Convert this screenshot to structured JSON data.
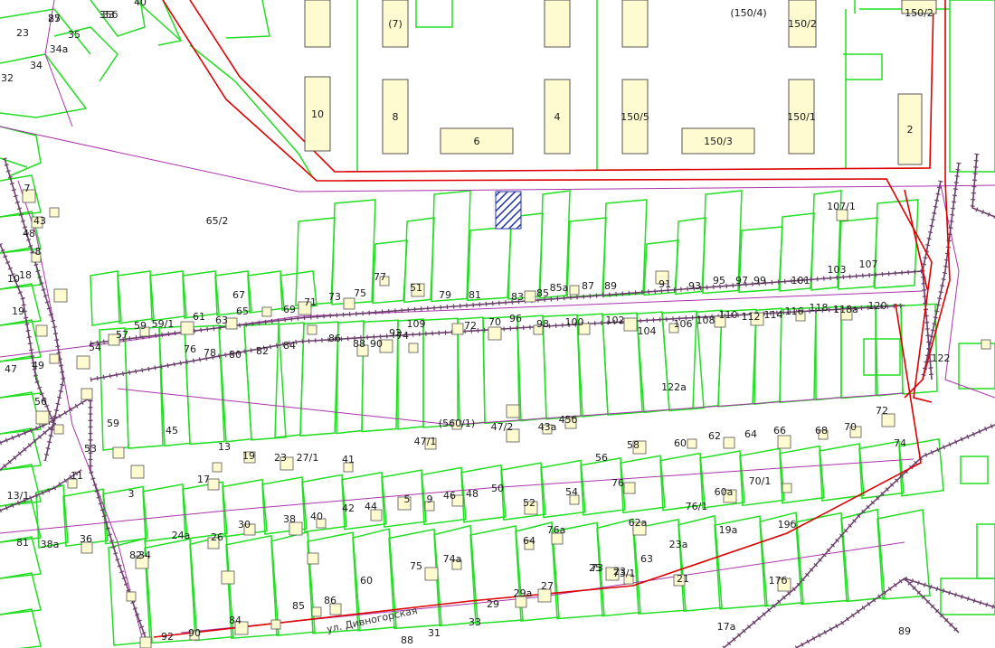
{
  "colors": {
    "parcel": "#22dd22",
    "boundary_red": "#dd0000",
    "street_line": "#aa33aa",
    "fence": "#6b3f6b",
    "building_fill": "#fffbd0",
    "building_stroke": "#555555",
    "hatch": "#2233aa"
  },
  "street_name": "ул. Дивногорская",
  "buildings_top": [
    {
      "id": "b10",
      "label": "10"
    },
    {
      "id": "b8",
      "label": "8"
    },
    {
      "id": "b6",
      "label": "6"
    },
    {
      "id": "b4",
      "label": "4"
    },
    {
      "id": "b150_5",
      "label": "150/5"
    },
    {
      "id": "b150_3",
      "label": "150/3"
    },
    {
      "id": "b150_1",
      "label": "150/1"
    },
    {
      "id": "b2",
      "label": "2"
    },
    {
      "id": "b150_2",
      "label": "150/2"
    },
    {
      "id": "b150_4",
      "label": "(150/4)"
    },
    {
      "id": "b7",
      "label": "(7)"
    },
    {
      "id": "b150_2b",
      "label": "150/2"
    }
  ],
  "labels": [
    "25",
    "33",
    "40",
    "23",
    "35",
    "34",
    "34а",
    "32",
    "10",
    "7",
    "8",
    "43",
    "48",
    "19",
    "18",
    "47",
    "49",
    "56",
    "54",
    "65/2",
    "107/1",
    "77",
    "75",
    "73",
    "71",
    "69",
    "67",
    "65",
    "63",
    "61",
    "59/1",
    "59",
    "57",
    "59",
    "45",
    "53",
    "51",
    "79",
    "81",
    "83",
    "85",
    "85а",
    "87",
    "89",
    "91",
    "93",
    "95",
    "97",
    "99",
    "101",
    "103",
    "107",
    "109",
    "92",
    "90",
    "88",
    "86",
    "84",
    "82",
    "80",
    "78",
    "76",
    "74",
    "72",
    "70",
    "96",
    "98",
    "100",
    "102",
    "104",
    "106",
    "108",
    "110",
    "112",
    "114",
    "116",
    "118",
    "118а",
    "120",
    "122",
    "122а",
    "(560/1)",
    "47/2",
    "43а",
    "45б",
    "47/1",
    "41",
    "27/1",
    "23",
    "19",
    "17",
    "13",
    "11",
    "13/1",
    "3",
    "5",
    "9",
    "46",
    "48",
    "50",
    "52",
    "54",
    "56",
    "58",
    "60",
    "62",
    "64",
    "66",
    "68",
    "70",
    "72",
    "74",
    "76",
    "76/1",
    "60а",
    "70/1",
    "62а",
    "64",
    "76а",
    "74а",
    "75",
    "73",
    "73/1",
    "63",
    "60",
    "38",
    "40",
    "42",
    "44",
    "30",
    "26",
    "24а",
    "34",
    "36",
    "38а",
    "81",
    "82",
    "84",
    "85",
    "86",
    "92",
    "90",
    "88",
    "31",
    "33",
    "29",
    "29а",
    "27",
    "25",
    "23",
    "23а",
    "21",
    "19а",
    "19б",
    "17б",
    "17а",
    "89",
    "87",
    "35б"
  ]
}
